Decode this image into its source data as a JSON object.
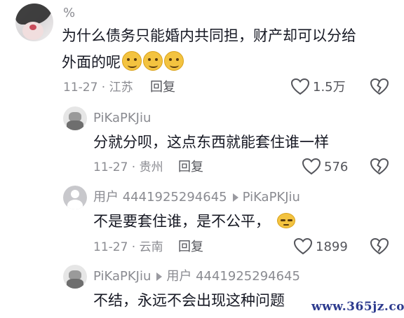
{
  "comments": [
    {
      "username": "%",
      "text_line1": "为什么债务只能婚内共同担，财产却可以分给",
      "text_line2": "外面的呢",
      "emoji_count": 3,
      "date_location": "11-27 · 江苏",
      "reply_label": "回复",
      "likes": "1.5万"
    },
    {
      "username": "PiKaPKJiu",
      "text": "分就分呗，这点东西就能套住谁一样",
      "date_location": "11-27 · 贵州",
      "reply_label": "回复",
      "likes": "576"
    },
    {
      "username": "用户 4441925294645",
      "reply_to": "PiKaPKJiu",
      "text": "不是要套住谁，是不公平，",
      "date_location": "11-27 · 云南",
      "reply_label": "回复",
      "likes": "1899"
    },
    {
      "username": "PiKaPKJiu",
      "reply_to": "用户 4441925294645",
      "text": "不结，永远不会出现这种问题"
    }
  ],
  "watermark": "www.365jz.com",
  "colors": {
    "text": "#161823",
    "meta": "#8a8b91",
    "watermark": "#2d3b8e"
  }
}
